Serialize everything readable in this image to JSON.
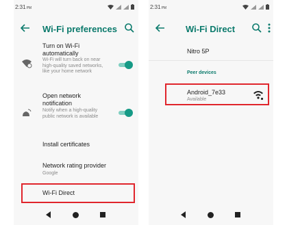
{
  "left": {
    "status": {
      "time": "2:31",
      "ampm": "PM"
    },
    "title": "Wi-Fi preferences",
    "items": [
      {
        "title": "Turn on Wi-Fi automatically",
        "subtitle": "Wi-Fi will turn back on near high-quality saved networks, like your home network",
        "toggle": "on"
      },
      {
        "title": "Open network notification",
        "subtitle": "Notify when a high-quality public network is available",
        "toggle": "on"
      },
      {
        "title": "Install certificates"
      },
      {
        "title": "Network rating provider",
        "subtitle": "Google"
      },
      {
        "title": "Wi-Fi Direct"
      }
    ],
    "icons": [
      "back-arrow-icon",
      "search-icon",
      "wifi-auto-icon",
      "wifi-notification-icon"
    ]
  },
  "right": {
    "status": {
      "time": "2:31",
      "ampm": "PM"
    },
    "title": "Wi-Fi Direct",
    "device_name": "Nitro 5P",
    "section": "Peer devices",
    "peers": [
      {
        "name": "Android_7e33",
        "status": "Available"
      }
    ],
    "icons": [
      "back-arrow-icon",
      "search-icon",
      "more-vert-icon",
      "wifi-signal-icon"
    ]
  },
  "colors": {
    "accent": "#0b7a6c",
    "highlight": "#e0242b",
    "toggle": "#169a86"
  }
}
